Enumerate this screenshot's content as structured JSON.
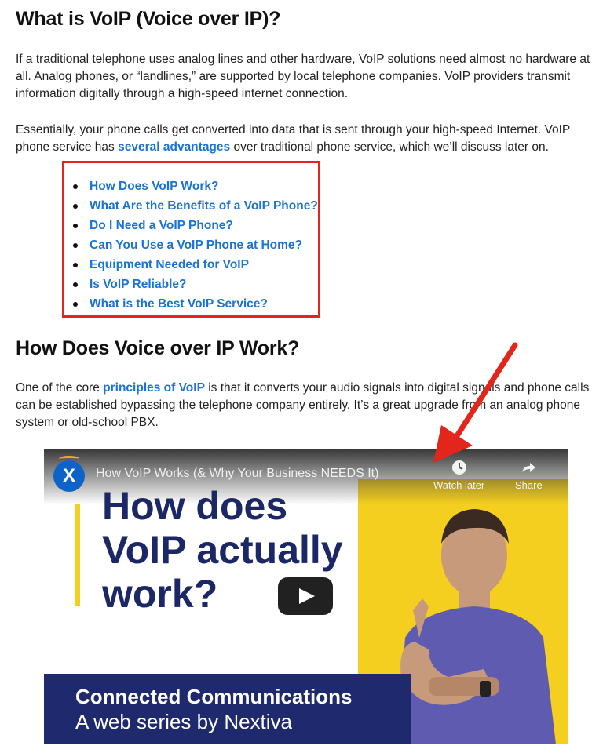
{
  "section1": {
    "heading": "What is VoIP (Voice over IP)?",
    "para1": "If a traditional telephone uses analog lines and other hardware, VoIP solutions need almost no hardware at all. Analog phones, or “landlines,” are supported by local telephone companies. VoIP providers transmit information digitally through a high-speed internet connection.",
    "para2_before": "Essentially, your phone calls get converted into data that is sent through your high-speed Internet. VoIP phone service has ",
    "para2_link": "several advantages",
    "para2_after": " over traditional phone service, which we’ll discuss later on."
  },
  "toc": [
    "How Does VoIP Work?",
    "What Are the Benefits of a VoIP Phone?",
    "Do I Need a VoIP Phone?",
    "Can You Use a VoIP Phone at Home?",
    "Equipment Needed for VoIP",
    "Is VoIP Reliable?",
    "What is the Best VoIP Service?"
  ],
  "section2": {
    "heading": "How Does Voice over IP Work?",
    "para_before": "One of the core ",
    "para_link": "principles of VoIP",
    "para_after": " is that it converts your audio signals into digital signals and phone calls can be established bypassing the telephone company entirely. It’s a great upgrade from an analog phone system or old-school PBX."
  },
  "video": {
    "channel_logo_letter": "X",
    "title": "How VoIP Works (& Why Your Business NEEDS It)",
    "watch_later_label": "Watch later",
    "share_label": "Share",
    "headline": [
      "How does",
      "VoIP actually",
      "work?"
    ],
    "banner_line1": "Connected Communications",
    "banner_line2": "A web series by Nextiva"
  },
  "colors": {
    "link": "#1a73d6",
    "highlight_box": "#e3261b",
    "brand_navy": "#1c2766",
    "brand_yellow": "#f5cf1f",
    "annotation_arrow": "#e3261b"
  }
}
